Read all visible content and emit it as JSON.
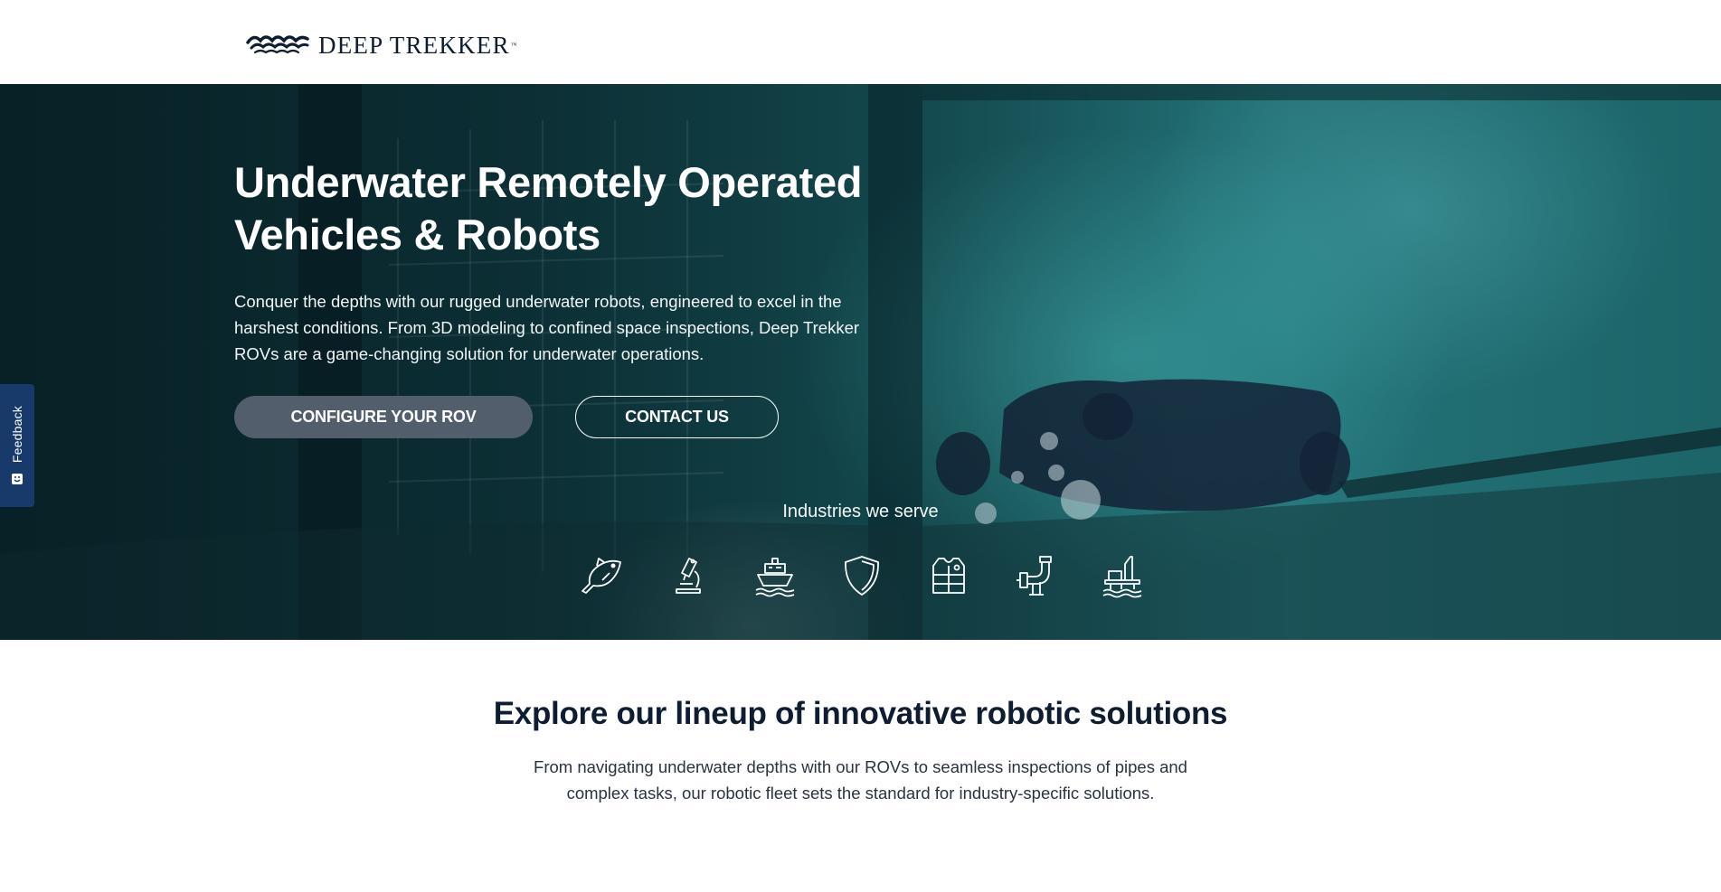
{
  "brand": {
    "name": "DEEP TREKKER",
    "trademark": "™",
    "color": "#0f1d33"
  },
  "hero": {
    "title": "Underwater Remotely Operated Vehicles & Robots",
    "subtitle": "Conquer the depths with our rugged underwater robots, engineered to excel in the harshest conditions. From 3D modeling to confined space inspections, Deep Trekker ROVs are a game-changing solution for underwater operations.",
    "buttons": {
      "configure": "CONFIGURE YOUR ROV",
      "contact": "CONTACT US"
    },
    "industries_label": "Industries we serve",
    "industry_icons": [
      "fish-icon",
      "microscope-icon",
      "ship-icon",
      "shield-icon",
      "life-vest-icon",
      "pipe-valve-icon",
      "offshore-rig-icon"
    ]
  },
  "feedback": {
    "label": "Feedback"
  },
  "lineup": {
    "title": "Explore our lineup of innovative robotic solutions",
    "text": "From navigating underwater depths with our ROVs to seamless inspections of pipes and complex tasks, our robotic fleet sets the standard for industry-specific solutions."
  },
  "colors": {
    "primary_button": "#535e6c",
    "feedback_tab": "#173a6b",
    "heading": "#0f1d33"
  }
}
